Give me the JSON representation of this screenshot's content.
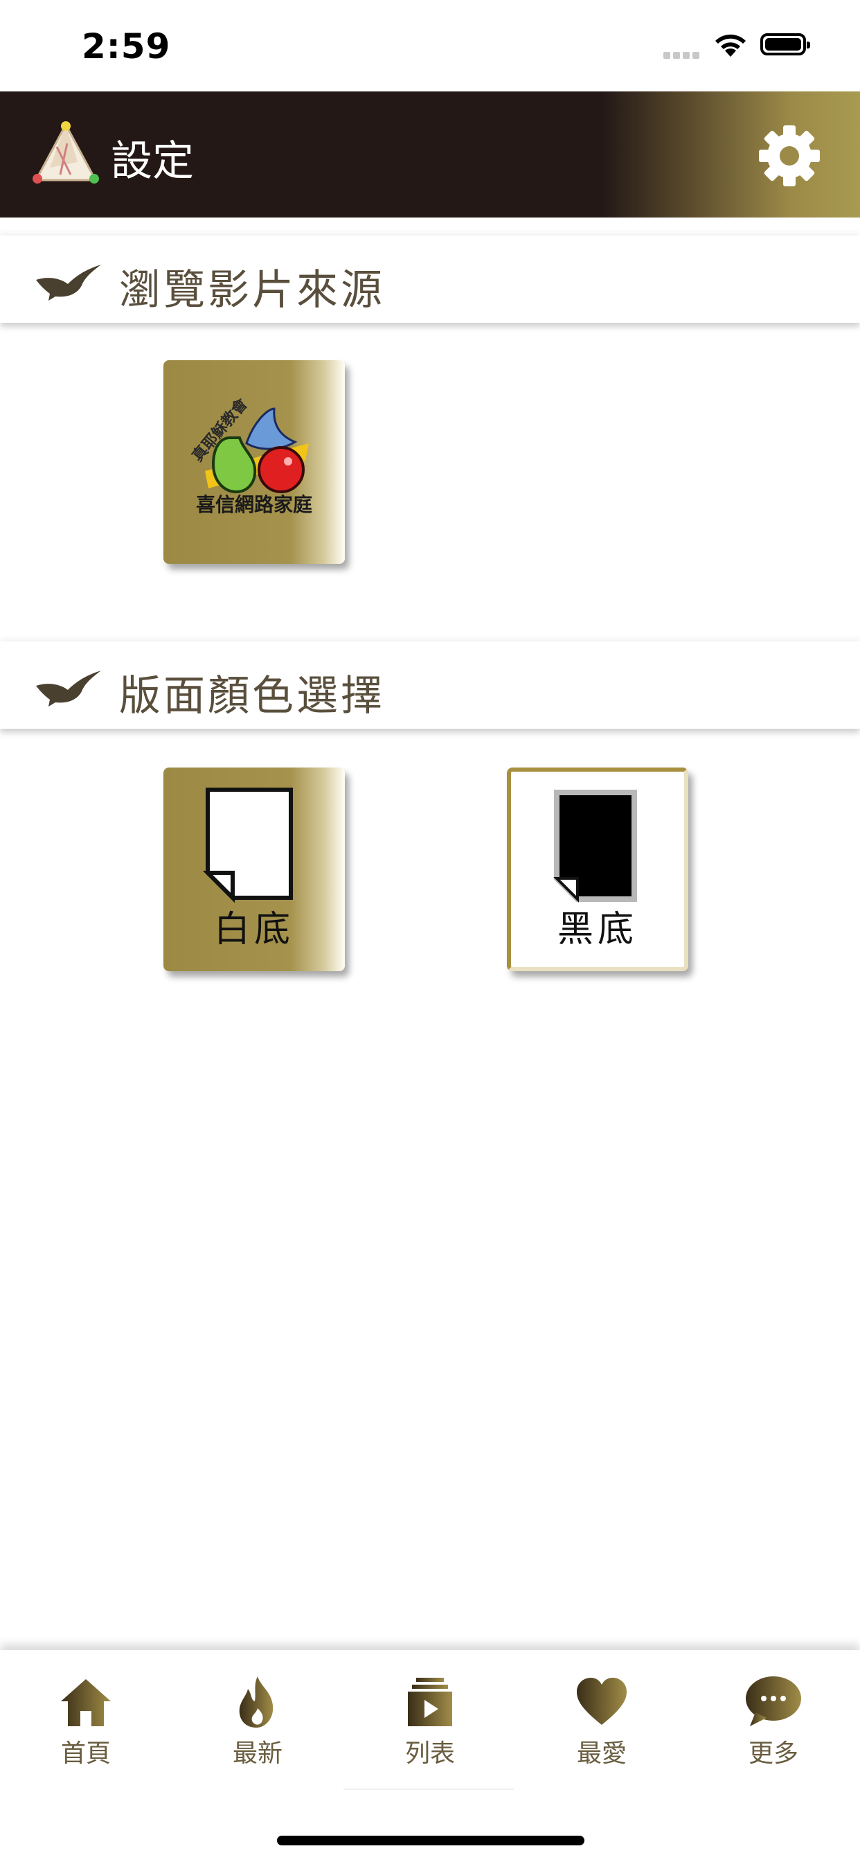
{
  "status_bar": {
    "time": "2:59"
  },
  "header": {
    "title": "設定",
    "settings_icon": "gear-icon",
    "logo_icon": "app-logo-icon"
  },
  "sections": [
    {
      "title": "瀏覽影片來源",
      "icon": "bird-icon"
    },
    {
      "title": "版面顏色選擇",
      "icon": "bird-icon"
    }
  ],
  "video_source": {
    "arc_text": "真耶穌教會",
    "name": "喜信網路家庭"
  },
  "theme_options": [
    {
      "label": "白底",
      "selected": true
    },
    {
      "label": "黑底",
      "selected": false
    }
  ],
  "tab_bar": {
    "items": [
      {
        "label": "首頁",
        "icon": "home-icon"
      },
      {
        "label": "最新",
        "icon": "flame-icon"
      },
      {
        "label": "列表",
        "icon": "playlist-icon"
      },
      {
        "label": "最愛",
        "icon": "heart-icon"
      },
      {
        "label": "更多",
        "icon": "chat-bubble-icon"
      }
    ]
  },
  "colors": {
    "header_bg": "#231816",
    "gold": "#9c8a44",
    "section_text": "#5a4f3d"
  }
}
